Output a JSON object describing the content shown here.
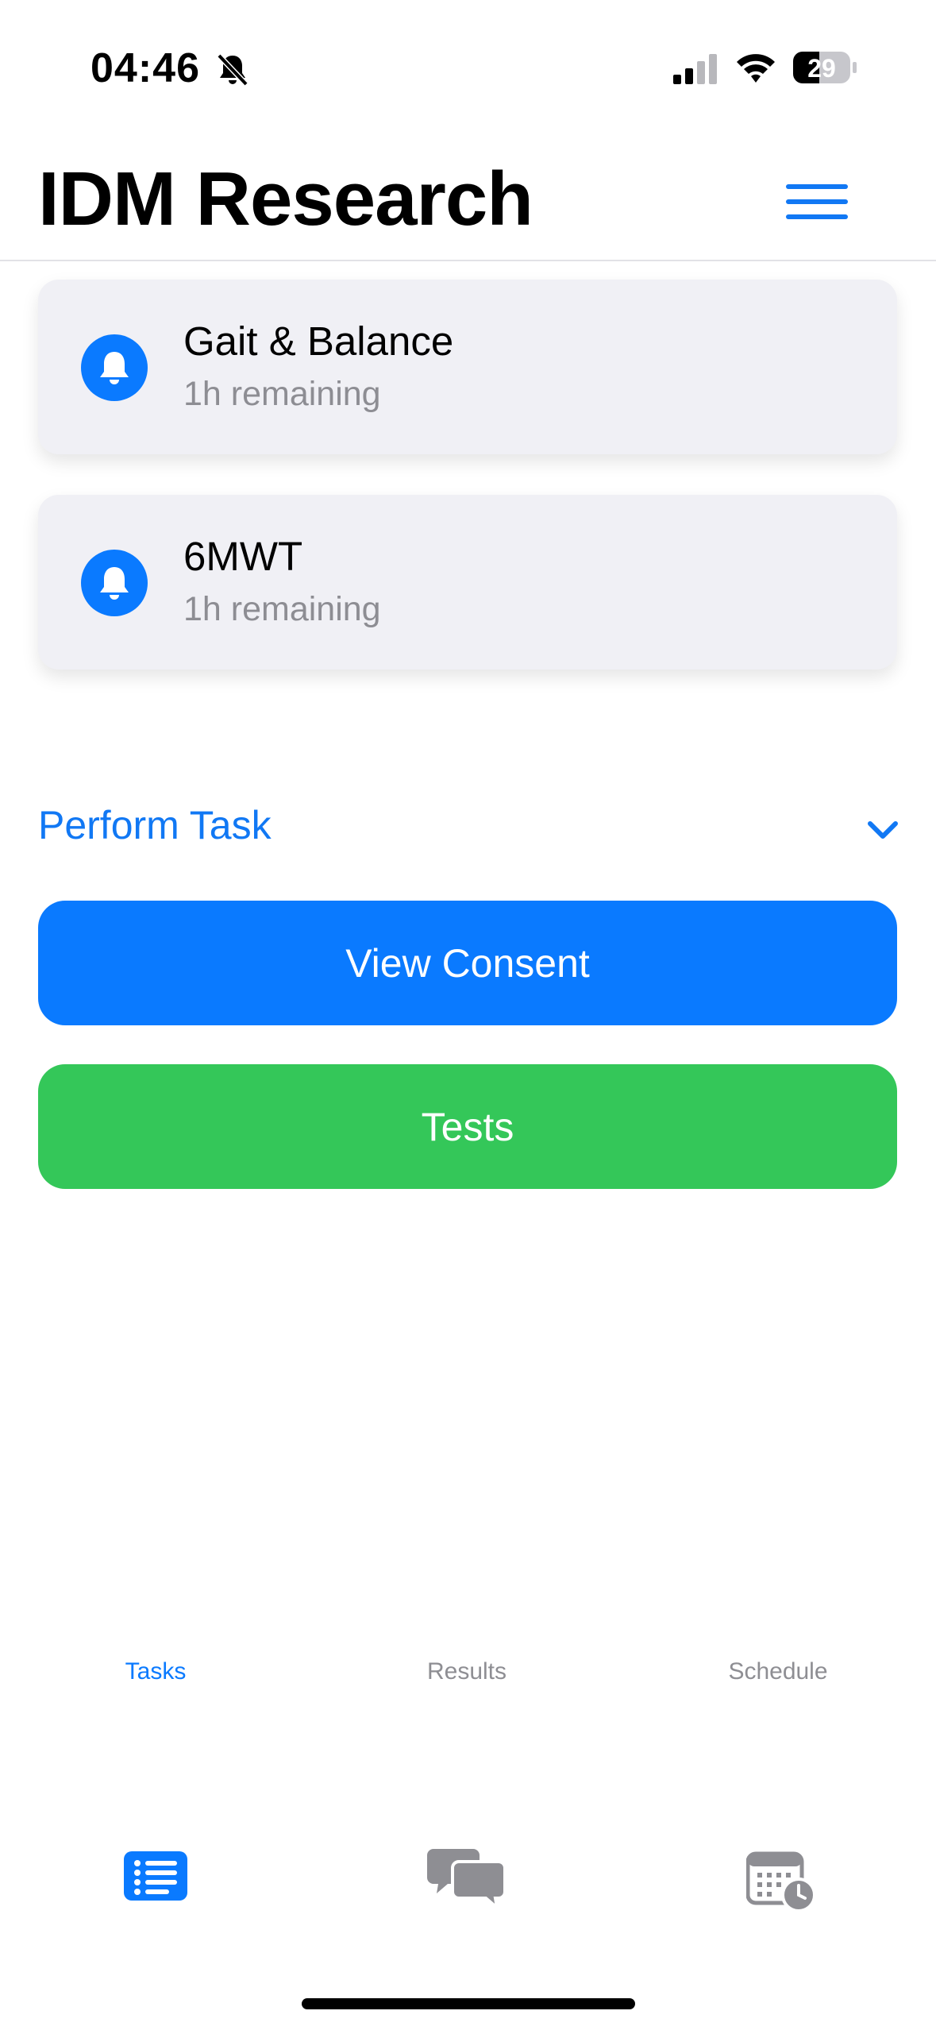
{
  "status_bar": {
    "time": "04:46",
    "battery": "29",
    "icons": [
      "bell-slash-icon",
      "cellular-signal-icon",
      "wifi-icon",
      "battery-icon"
    ]
  },
  "header": {
    "title": "IDM Research",
    "menu_icon": "hamburger-menu-icon"
  },
  "tasks": [
    {
      "title": "Gait & Balance",
      "subtitle": "1h remaining",
      "icon": "bell-icon"
    },
    {
      "title": "6MWT",
      "subtitle": "1h remaining",
      "icon": "bell-icon"
    }
  ],
  "perform_task": {
    "label": "Perform Task",
    "icon": "chevron-down-icon"
  },
  "buttons": {
    "view_consent": "View Consent",
    "tests": "Tests"
  },
  "tab_bar": {
    "items": [
      {
        "label": "Tasks",
        "icon": "list-icon",
        "active": true
      },
      {
        "label": "Results",
        "icon": "chat-bubbles-icon",
        "active": false
      },
      {
        "label": "Schedule",
        "icon": "calendar-clock-icon",
        "active": false
      }
    ]
  },
  "colors": {
    "accent": "#0A7AFF",
    "success": "#34C759",
    "card_background": "#F0F0F5",
    "secondary_text": "#8D8D93",
    "tab_inactive": "#8E8E93"
  }
}
